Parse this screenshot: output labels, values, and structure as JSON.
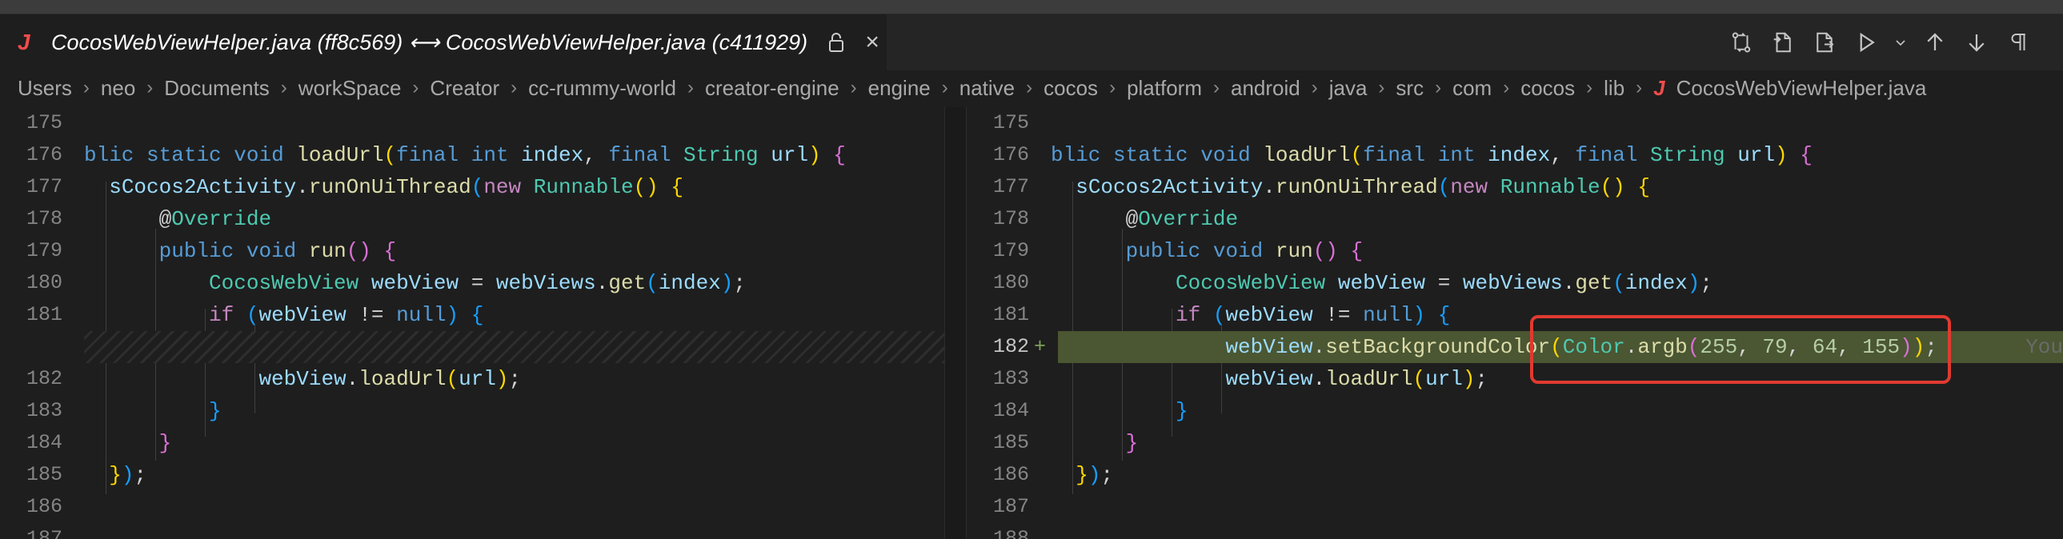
{
  "tab": {
    "file_icon_glyph": "J",
    "title": "CocosWebViewHelper.java (ff8c569) ⟷ CocosWebViewHelper.java (c411929)",
    "lock_icon": "lock-icon",
    "close_glyph": "×"
  },
  "toolbar": {
    "icons": [
      "compare-changes-icon",
      "open-file-icon",
      "open-changes-icon",
      "run-icon",
      "run-dropdown-icon",
      "previous-change-icon",
      "next-change-icon",
      "toggle-whitespace-icon"
    ]
  },
  "breadcrumb": {
    "items": [
      "Users",
      "neo",
      "Documents",
      "workSpace",
      "Creator",
      "cc-rummy-world",
      "creator-engine",
      "engine",
      "native",
      "cocos",
      "platform",
      "android",
      "java",
      "src",
      "com",
      "cocos",
      "lib"
    ],
    "file_icon_glyph": "J",
    "file": "CocosWebViewHelper.java",
    "separator": "›"
  },
  "diff": {
    "left": {
      "line_numbers": [
        "175",
        "176",
        "177",
        "178",
        "179",
        "180",
        "181",
        "",
        "182",
        "183",
        "184",
        "185",
        "186",
        "187"
      ]
    },
    "right": {
      "line_numbers": [
        "175",
        "176",
        "177",
        "178",
        "179",
        "180",
        "181",
        "182",
        "183",
        "184",
        "185",
        "186",
        "187",
        "188"
      ],
      "added_marker": "+",
      "blame_text": "You"
    }
  },
  "colors": {
    "added_line_bg": "#4b5632",
    "annotation_box": "#e03a30",
    "java_icon": "#f14c4c"
  }
}
